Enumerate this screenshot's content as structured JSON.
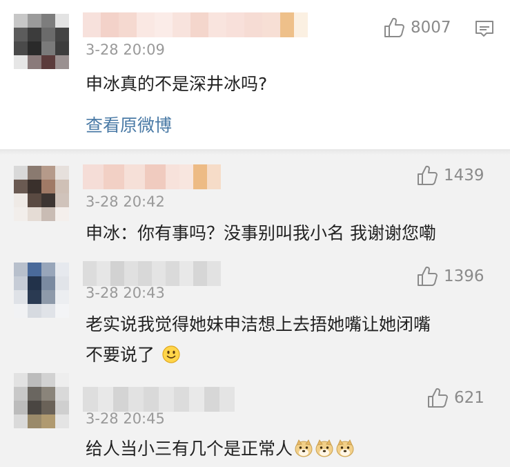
{
  "main": {
    "time": "3-28 20:09",
    "text": "申冰真的不是深井冰吗?",
    "likes": "8007",
    "view_original": "查看原微博"
  },
  "replies": [
    {
      "time": "3-28 20:42",
      "text": "申冰：你有事吗？没事别叫我小名 我谢谢您嘞",
      "likes": "1439"
    },
    {
      "time": "3-28 20:43",
      "text_line1": "老实说我觉得她妹申洁想上去捂她嘴让她闭嘴",
      "text_line2": "不要说了",
      "likes": "1396",
      "emoji": "smile-emoji"
    },
    {
      "time": "3-28 20:45",
      "text": "给人当小三有几个是正常人",
      "likes": "621",
      "emoji": "doge-emoji"
    }
  ],
  "colors": {
    "link": "#4a7aa6",
    "meta": "#999999",
    "reply_bg": "#f2f2f2"
  }
}
